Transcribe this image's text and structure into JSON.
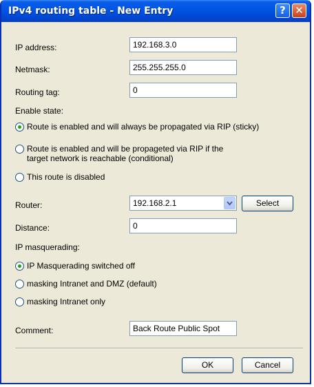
{
  "window": {
    "title": "IPv4 routing table - New Entry",
    "help_glyph": "?",
    "close_glyph": "✕"
  },
  "fields": {
    "ip_address": {
      "label": "IP address:",
      "value": "192.168.3.0"
    },
    "netmask": {
      "label": "Netmask:",
      "value": "255.255.255.0"
    },
    "routing_tag": {
      "label": "Routing tag:",
      "value": "0"
    },
    "router": {
      "label": "Router:",
      "value": "192.168.2.1"
    },
    "distance": {
      "label": "Distance:",
      "value": "0"
    },
    "comment": {
      "label": "Comment:",
      "value": "Back Route Public Spot"
    }
  },
  "enable_state": {
    "label": "Enable state:",
    "options": [
      {
        "label": "Route is enabled and will always be propagated via RIP (sticky)",
        "selected": true
      },
      {
        "label": "Route is enabled and will be propageted via RIP if the target network is reachable (conditional)",
        "selected": false
      },
      {
        "label": "This route is disabled",
        "selected": false
      }
    ]
  },
  "masquerading": {
    "label": "IP masquerading:",
    "options": [
      {
        "label": "IP Masquerading switched off",
        "selected": true
      },
      {
        "label": "masking Intranet and DMZ (default)",
        "selected": false
      },
      {
        "label": "masking Intranet only",
        "selected": false
      }
    ]
  },
  "buttons": {
    "select": "Select",
    "ok": "OK",
    "cancel": "Cancel"
  }
}
